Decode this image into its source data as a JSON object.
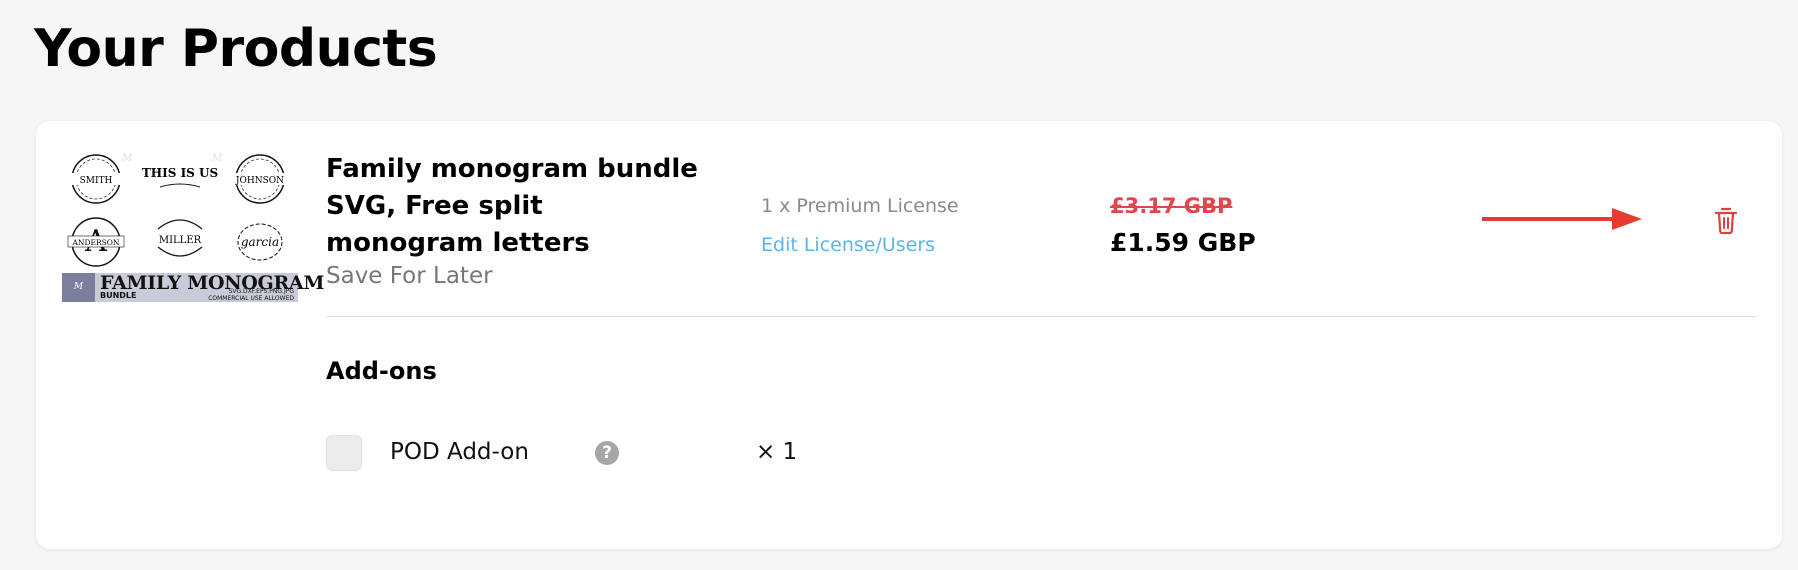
{
  "page_title": "Your Products",
  "product": {
    "name": "Family monogram bundle SVG, Free split monogram letters",
    "save_for_later": "Save For Later",
    "license": "1 x Premium License",
    "edit_license": "Edit License/Users",
    "original_price": "£3.17 GBP",
    "sale_price": "£1.59 GBP",
    "thumbnail": {
      "monograms": [
        "SMITH",
        "THIS IS US",
        "JOHNSON",
        "ANDERSON",
        "MILLER",
        "garcia"
      ],
      "banner_title": "FAMILY MONOGRAM",
      "banner_subtitle": "BUNDLE",
      "banner_formats": "SVG.DXF.EPS.PNG.JPG",
      "banner_note": "COMMERCIAL USE ALLOWED"
    }
  },
  "addons": {
    "title": "Add-ons",
    "items": [
      {
        "label": "POD Add-on",
        "help": "?",
        "quantity": "× 1",
        "checked": false
      }
    ]
  },
  "colors": {
    "old_price": "#e0474c",
    "link": "#5ab4ec",
    "arrow": "#e43d2f",
    "trash": "#e03f3f"
  },
  "icons": {
    "delete": "trash-icon",
    "pointer": "arrow-right-icon",
    "help": "question-circle-icon"
  }
}
